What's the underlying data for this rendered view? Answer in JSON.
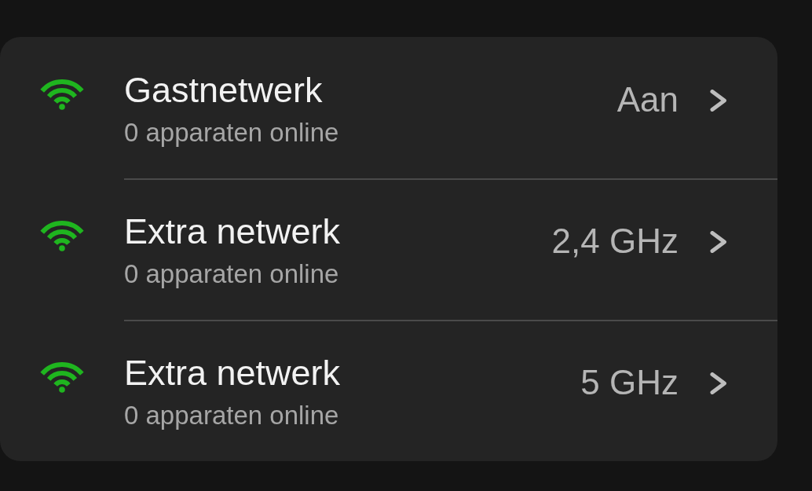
{
  "networks": [
    {
      "name": "Gastnetwerk",
      "status": "0 apparaten online",
      "value": "Aan"
    },
    {
      "name": "Extra netwerk",
      "status": "0 apparaten online",
      "value": "2,4 GHz"
    },
    {
      "name": "Extra netwerk",
      "status": "0 apparaten online",
      "value": "5 GHz"
    }
  ]
}
